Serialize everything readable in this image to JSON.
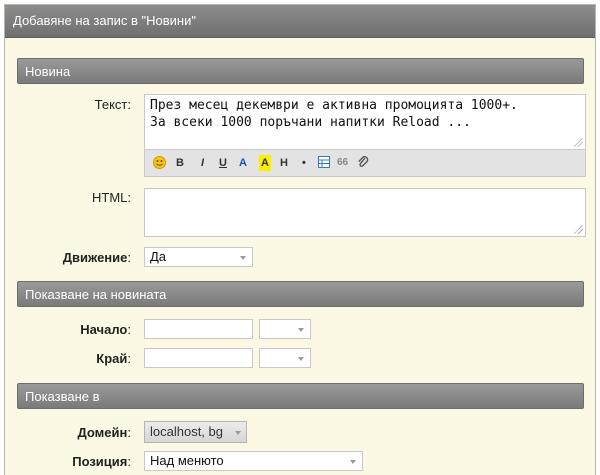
{
  "window": {
    "title": "Добавяне на запис в \"Новини\""
  },
  "sections": {
    "news": "Новина",
    "display": "Показване на новината",
    "shown_in": "Показване в"
  },
  "fields": {
    "text_label": "Текст:",
    "text_value": "През месец декември е активна промоцията 1000+.\nЗа всеки 1000 поръчани напитки Reload ...",
    "html_label": "HTML:",
    "html_value": "",
    "movement_label": "Движение",
    "movement_value": "Да",
    "start_label": "Начало",
    "end_label": "Край",
    "domain_label": "Домейн",
    "domain_value": "localhost, bg",
    "position_label": "Позиция",
    "position_value": "Над менюто",
    "colon": ":"
  },
  "toolbar": {
    "bold": "B",
    "italic": "I",
    "underline": "U",
    "color_a": "A",
    "highlight_a": "A",
    "heading": "H",
    "list": "•",
    "quote": "66",
    "icons": [
      "smiley-icon",
      "table-icon",
      "paperclip-icon"
    ]
  },
  "colors": {
    "accent_blue": "#1f4fbf",
    "highlight_yellow": "#ffee00",
    "panel_bg": "#fbf9e4"
  }
}
